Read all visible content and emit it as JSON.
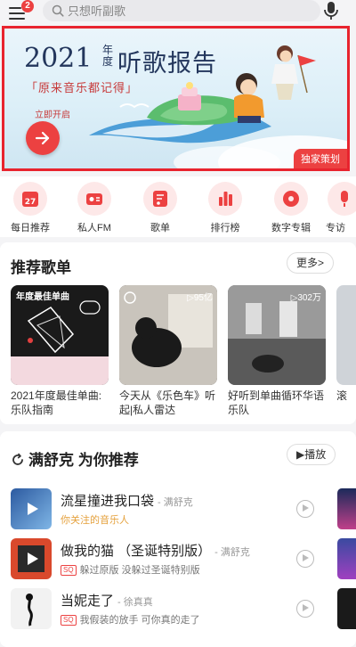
{
  "topbar": {
    "menu_badge": "2",
    "search_placeholder": "只想听副歌"
  },
  "banner": {
    "year": "2021",
    "year_suffix": "年度",
    "title": "听歌报告",
    "subtitle": "「原来音乐都记得」",
    "open_label": "立即开启",
    "tag": "独家策划"
  },
  "quick_entries": [
    {
      "label": "每日推荐",
      "icon": "calendar-icon",
      "badge": "27"
    },
    {
      "label": "私人FM",
      "icon": "radio-icon"
    },
    {
      "label": "歌单",
      "icon": "playlist-icon"
    },
    {
      "label": "排行榜",
      "icon": "chart-icon"
    },
    {
      "label": "数字专辑",
      "icon": "album-icon"
    },
    {
      "label": "专访",
      "icon": "mic-icon"
    }
  ],
  "recommend": {
    "title": "推荐歌单",
    "more_label": "更多>",
    "playlists": [
      {
        "name": "2021年度最佳单曲:乐队指南",
        "count": "",
        "cover_text": "年度最佳单曲",
        "cover_color": "#1a1a1a"
      },
      {
        "name": "今天从《乐色车》听起|私人雷达",
        "count": "95亿",
        "cover_color": "#3a3532"
      },
      {
        "name": "好听到单曲循环华语乐队",
        "count": "302万",
        "cover_color": "#7a7a7a"
      },
      {
        "name": "滚",
        "count": "",
        "cover_color": "#cfd3d8"
      }
    ]
  },
  "foryou": {
    "title": "满舒克 为你推荐",
    "play_label": "播放",
    "songs": [
      {
        "title": "流星撞进我口袋",
        "artist": "- 满舒克",
        "sub": "你关注的音乐人",
        "sq": false,
        "cover_color": "#4a86c8"
      },
      {
        "title": "做我的猫 （圣诞特别版）",
        "artist": "- 满舒克",
        "sub": "躲过原版 没躲过圣诞特别版",
        "sq": true,
        "cover_color": "#d9492c"
      },
      {
        "title": "当妮走了",
        "artist": "- 徐真真",
        "sub": "我假装的放手 可你真的走了",
        "sq": true,
        "cover_color": "#f2f2f2"
      }
    ]
  }
}
